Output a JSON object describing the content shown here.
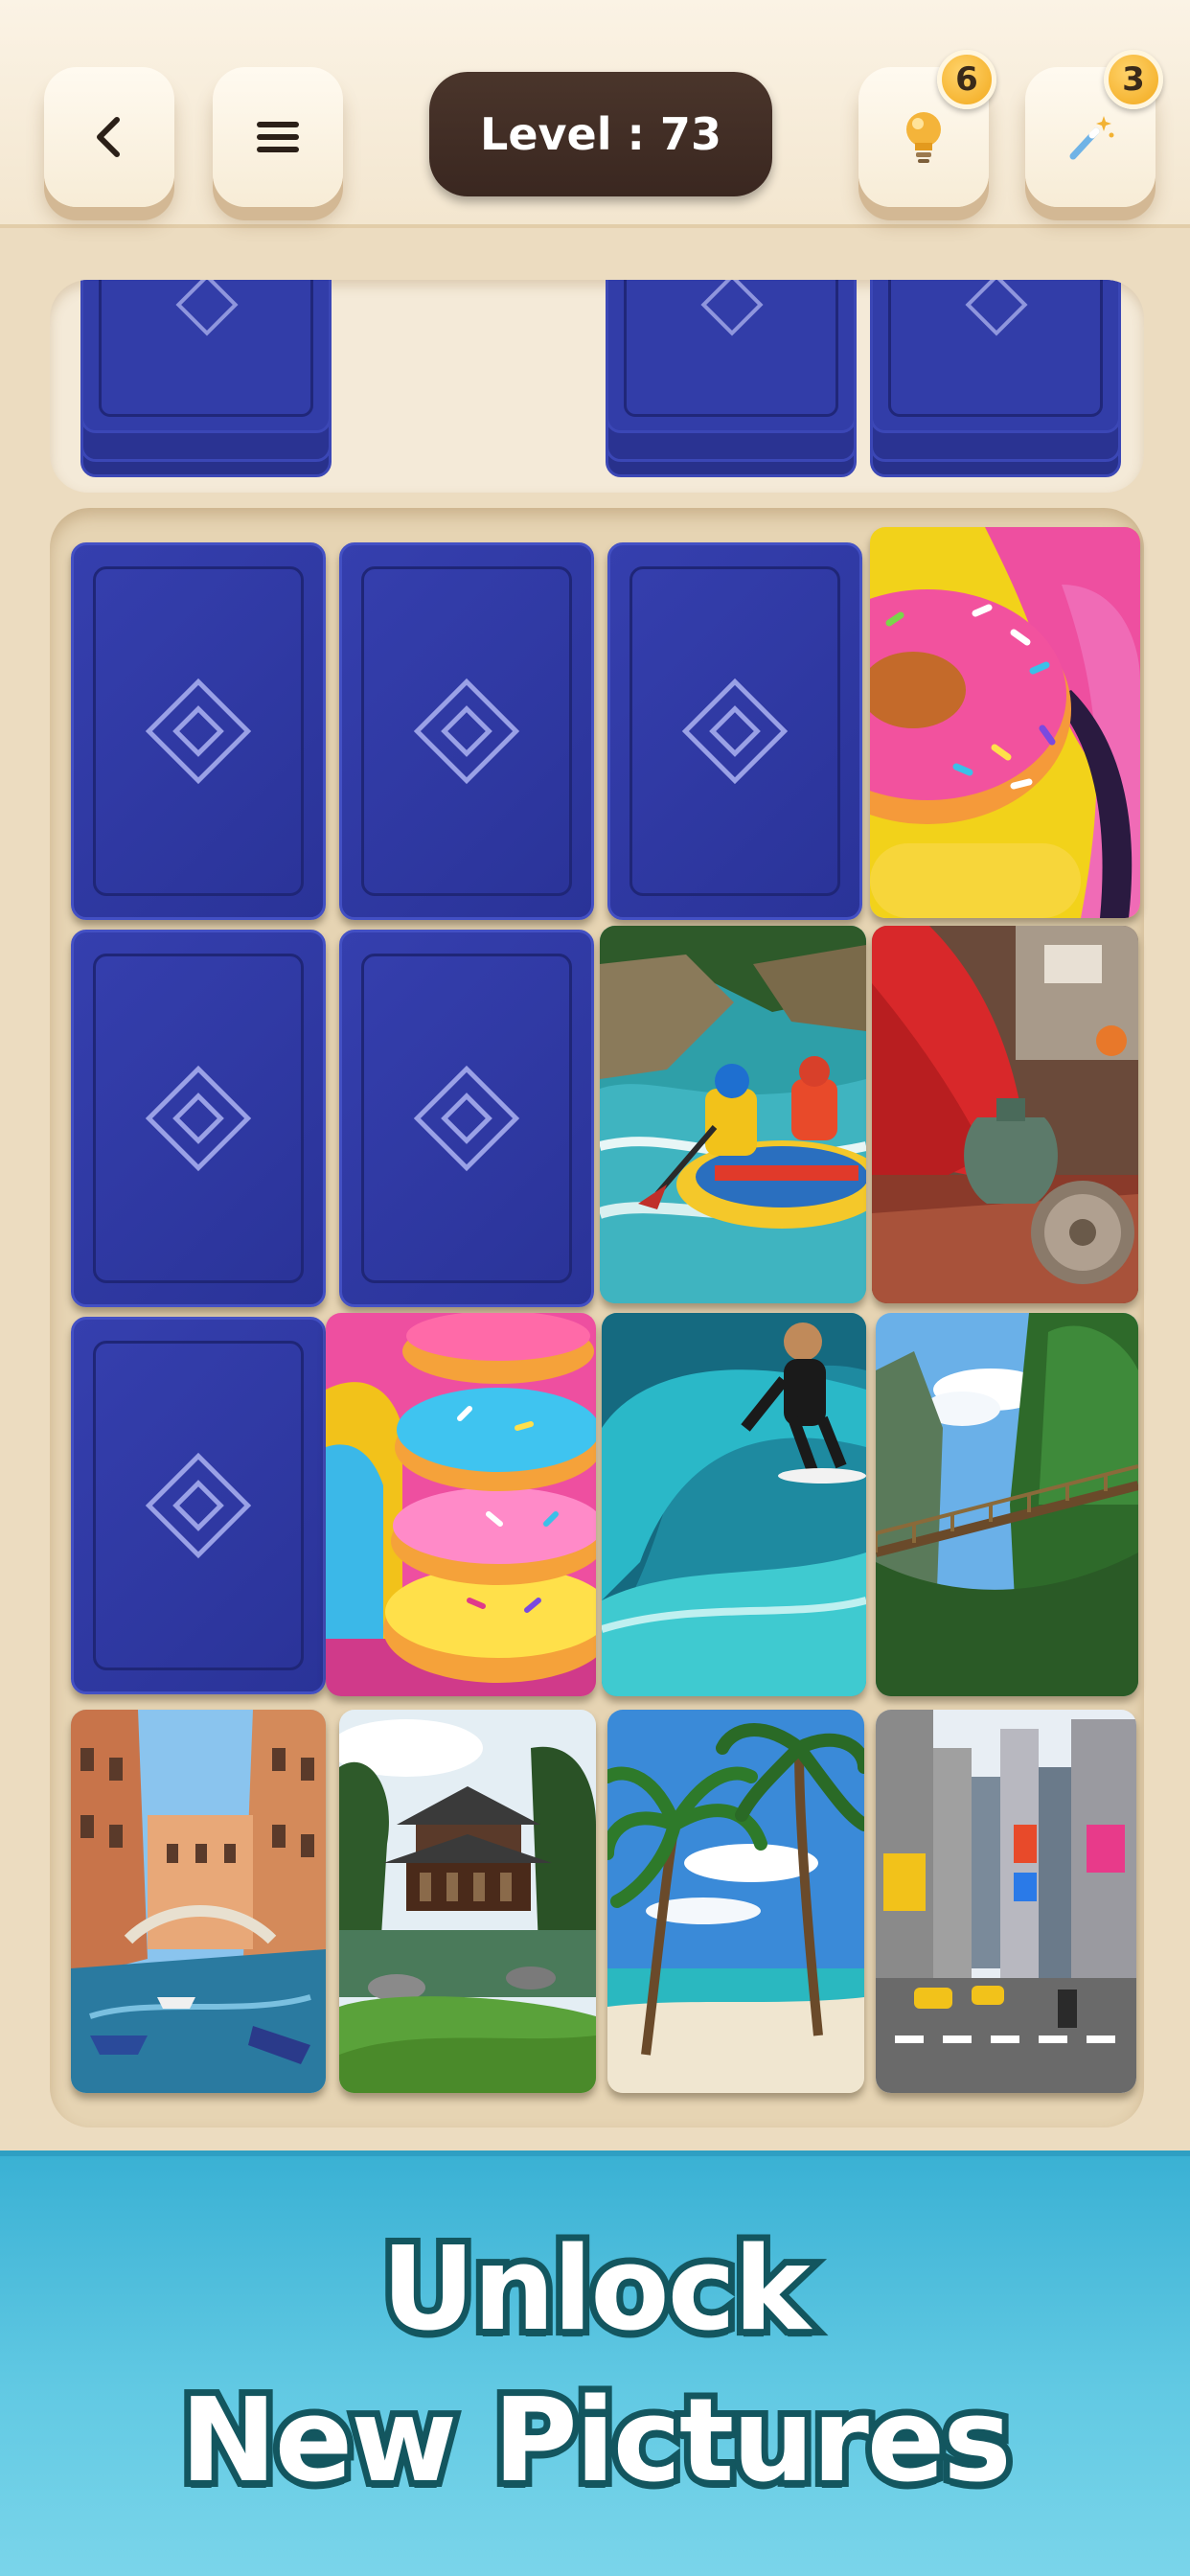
{
  "header": {
    "level_text": "Level : 73",
    "hint_count": "6",
    "wand_count": "3"
  },
  "icons": {
    "back": "chevron-left-icon",
    "menu": "hamburger-menu-icon",
    "hint": "lightbulb-icon",
    "wand": "magic-wand-icon",
    "card_back": "diamond-icon"
  },
  "colors": {
    "card_back": "#2f3aa3",
    "board": "#e6d4b3",
    "banner": "#4bbfdd",
    "banner_text_outline": "#13565f",
    "badge": "#f2a91c",
    "level_pill": "#3f2c24"
  },
  "stack_tray": {
    "stacks_visible": 3
  },
  "board": {
    "rows": 4,
    "cols": 4,
    "cards": [
      {
        "state": "face-down"
      },
      {
        "state": "face-down"
      },
      {
        "state": "face-down"
      },
      {
        "state": "face-up",
        "picture": "donut"
      },
      {
        "state": "face-down"
      },
      {
        "state": "face-down"
      },
      {
        "state": "face-up",
        "picture": "river-rafting"
      },
      {
        "state": "face-up",
        "picture": "market-pottery"
      },
      {
        "state": "face-down"
      },
      {
        "state": "face-up",
        "picture": "donut-stack"
      },
      {
        "state": "face-up",
        "picture": "surfer-wave"
      },
      {
        "state": "face-up",
        "picture": "jungle-bridge"
      },
      {
        "state": "face-up",
        "picture": "venice-canal"
      },
      {
        "state": "face-up",
        "picture": "pagoda-garden"
      },
      {
        "state": "face-up",
        "picture": "palm-beach"
      },
      {
        "state": "face-up",
        "picture": "times-square"
      }
    ]
  },
  "banner": {
    "line1": "Unlock",
    "line2": "New Pictures"
  }
}
